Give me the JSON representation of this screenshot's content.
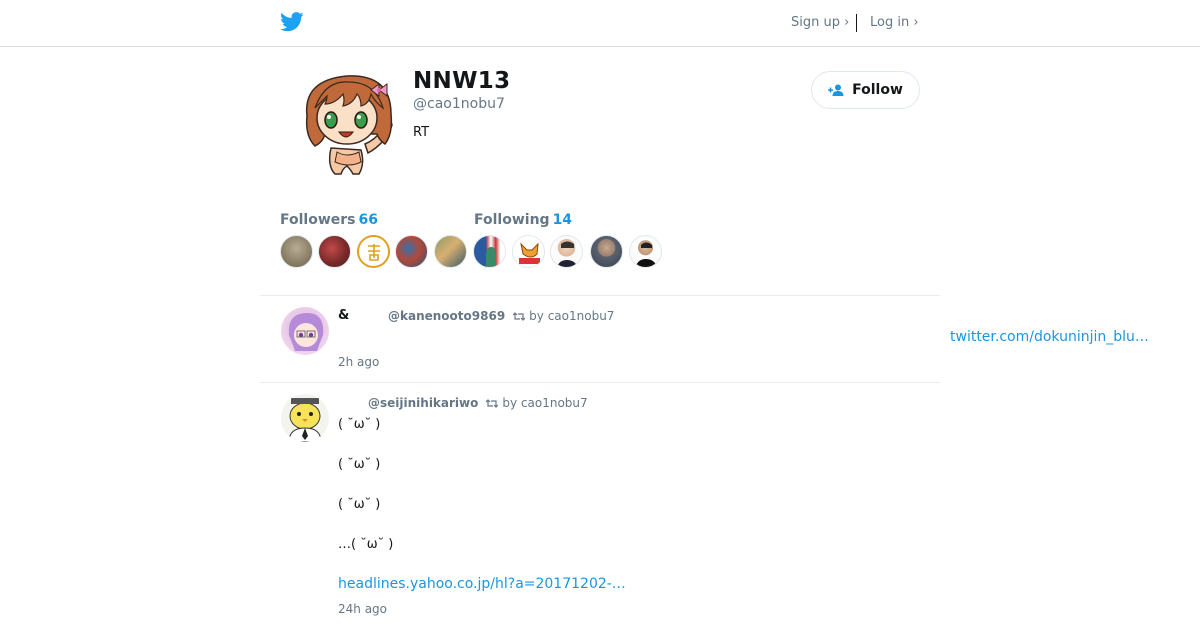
{
  "header": {
    "logo": "twitter-bird-icon",
    "signup_label": "Sign up ›",
    "login_label": "Log in ›"
  },
  "profile": {
    "name": "NNW13",
    "handle": "@cao1nobu7",
    "bio": "RT",
    "follow_label": "Follow"
  },
  "stats": {
    "followers_label": "Followers",
    "followers_count": "66",
    "following_label": "Following",
    "following_count": "14"
  },
  "accent_color": "#1b95e0",
  "tweets": [
    {
      "name": "&",
      "handle": "@kanenooto9869",
      "retweeted_by": "by cao1nobu7",
      "time": "2h ago",
      "side_link": "twitter.com/dokuninjin_blu…"
    },
    {
      "name": "",
      "handle": "@seijinihikariwo",
      "retweeted_by": "by cao1nobu7",
      "lines": [
        "( ˘ω˘ )",
        "( ˘ω˘ )",
        "( ˘ω˘ )",
        "…( ˘ω˘ )"
      ],
      "link": "headlines.yahoo.co.jp/hl?a=20171202-…",
      "time": "24h ago"
    }
  ]
}
